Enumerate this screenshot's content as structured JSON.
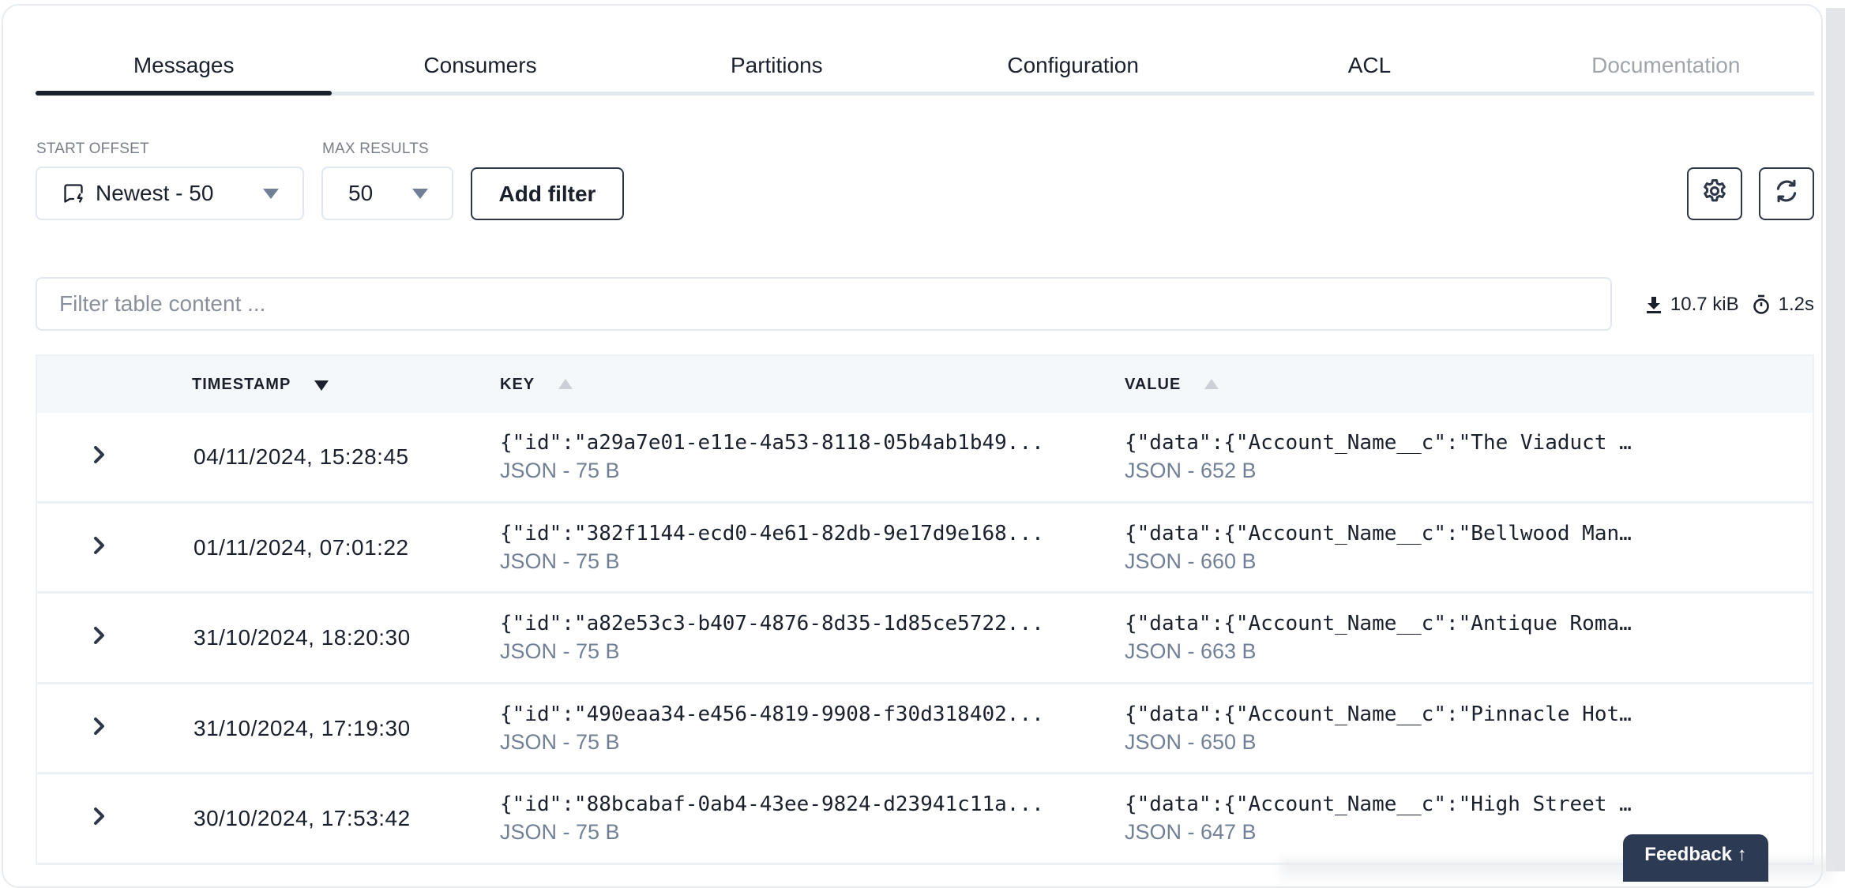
{
  "tabs": [
    {
      "label": "Messages",
      "active": true,
      "disabled": false
    },
    {
      "label": "Consumers",
      "active": false,
      "disabled": false
    },
    {
      "label": "Partitions",
      "active": false,
      "disabled": false
    },
    {
      "label": "Configuration",
      "active": false,
      "disabled": false
    },
    {
      "label": "ACL",
      "active": false,
      "disabled": false
    },
    {
      "label": "Documentation",
      "active": false,
      "disabled": true
    }
  ],
  "controls": {
    "start_offset_label": "START OFFSET",
    "start_offset_value": "Newest - 50",
    "start_offset_icon": "message-bolt-icon",
    "max_results_label": "MAX RESULTS",
    "max_results_value": "50",
    "add_filter_label": "Add filter",
    "settings_icon": "gear-icon",
    "refresh_icon": "refresh-icon"
  },
  "filter": {
    "placeholder": "Filter table content ...",
    "value": ""
  },
  "stats": {
    "download_icon": "download-icon",
    "size": "10.7 kiB",
    "timer_icon": "stopwatch-icon",
    "duration": "1.2s"
  },
  "table": {
    "columns": [
      {
        "label": "TIMESTAMP",
        "sort": "desc"
      },
      {
        "label": "KEY",
        "sort": "none"
      },
      {
        "label": "VALUE",
        "sort": "none"
      }
    ],
    "rows": [
      {
        "timestamp": "04/11/2024, 15:28:45",
        "key": "{\"id\":\"a29a7e01-e11e-4a53-8118-05b4ab1b49...",
        "key_meta": "JSON - 75 B",
        "value": "{\"data\":{\"Account_Name__c\":\"The Viaduct …",
        "value_meta": "JSON - 652 B"
      },
      {
        "timestamp": "01/11/2024, 07:01:22",
        "key": "{\"id\":\"382f1144-ecd0-4e61-82db-9e17d9e168...",
        "key_meta": "JSON - 75 B",
        "value": "{\"data\":{\"Account_Name__c\":\"Bellwood Man…",
        "value_meta": "JSON - 660 B"
      },
      {
        "timestamp": "31/10/2024, 18:20:30",
        "key": "{\"id\":\"a82e53c3-b407-4876-8d35-1d85ce5722...",
        "key_meta": "JSON - 75 B",
        "value": "{\"data\":{\"Account_Name__c\":\"Antique Roma…",
        "value_meta": "JSON - 663 B"
      },
      {
        "timestamp": "31/10/2024, 17:19:30",
        "key": "{\"id\":\"490eaa34-e456-4819-9908-f30d318402...",
        "key_meta": "JSON - 75 B",
        "value": "{\"data\":{\"Account_Name__c\":\"Pinnacle Hot…",
        "value_meta": "JSON - 650 B"
      },
      {
        "timestamp": "30/10/2024, 17:53:42",
        "key": "{\"id\":\"88bcabaf-0ab4-43ee-9824-d23941c11a...",
        "key_meta": "JSON - 75 B",
        "value": "{\"data\":{\"Account_Name__c\":\"High Street …",
        "value_meta": "JSON - 647 B"
      }
    ]
  },
  "feedback": {
    "label": "Feedback ↑"
  },
  "colors": {
    "primary_text": "#1a202c",
    "muted_text": "#718096",
    "border": "#e2e8f0",
    "header_bg": "#f5f8fb",
    "feedback_bg": "#2d3a54"
  }
}
